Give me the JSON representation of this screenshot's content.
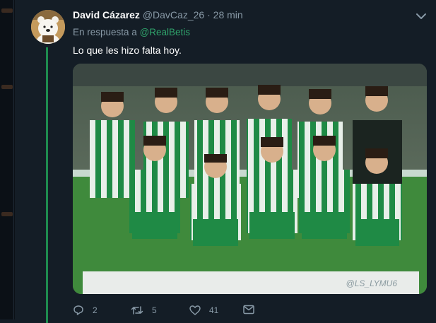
{
  "tweet": {
    "display_name": "David Cázarez",
    "handle": "@DavCaz_26",
    "separator": " · ",
    "time": "28 min",
    "reply_prefix": "En respuesta a",
    "reply_to": "@RealBetis",
    "text": "Lo que les hizo falta hoy.",
    "image": {
      "watermark": "@LS_LYMU6"
    }
  },
  "actions": {
    "replies": "2",
    "retweets": "5",
    "likes": "41"
  },
  "icons": {
    "avatar": "bear-avatar",
    "menu": "chevron-down-icon",
    "reply": "reply-icon",
    "retweet": "retweet-icon",
    "like": "heart-icon",
    "dm": "envelope-icon"
  },
  "colors": {
    "background": "#141d26",
    "accent_green": "#2fa36b",
    "muted": "#8899a6",
    "thread_line": "#1e8c4f"
  }
}
